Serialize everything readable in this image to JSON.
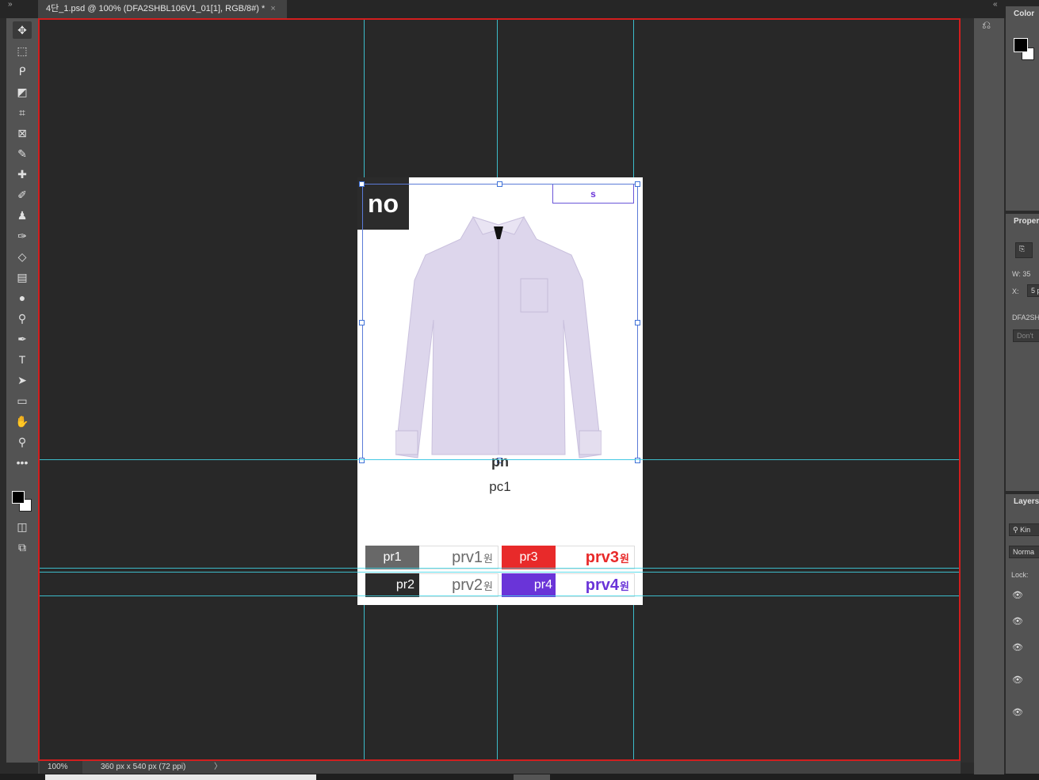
{
  "tab": {
    "title": "4단_1.psd @ 100% (DFA2SHBL106V1_01[1], RGB/8#) *",
    "close": "×"
  },
  "tabbar": {
    "collapse_left": "»",
    "collapse_right": "«"
  },
  "tools": [
    {
      "icon": "move-icon",
      "glyph": "✥"
    },
    {
      "icon": "rect-marquee-icon",
      "glyph": "⬚"
    },
    {
      "icon": "lasso-icon",
      "glyph": "ᑭ"
    },
    {
      "icon": "object-select-icon",
      "glyph": "◩"
    },
    {
      "icon": "crop-icon",
      "glyph": "⌗"
    },
    {
      "icon": "frame-icon",
      "glyph": "⊠"
    },
    {
      "icon": "eyedropper-icon",
      "glyph": "✎"
    },
    {
      "icon": "healing-brush-icon",
      "glyph": "✚"
    },
    {
      "icon": "brush-icon",
      "glyph": "✐"
    },
    {
      "icon": "stamp-icon",
      "glyph": "♟"
    },
    {
      "icon": "history-brush-icon",
      "glyph": "✑"
    },
    {
      "icon": "eraser-icon",
      "glyph": "◇"
    },
    {
      "icon": "gradient-icon",
      "glyph": "▤"
    },
    {
      "icon": "blur-icon",
      "glyph": "●"
    },
    {
      "icon": "dodge-icon",
      "glyph": "⚲"
    },
    {
      "icon": "pen-icon",
      "glyph": "✒"
    },
    {
      "icon": "type-icon",
      "glyph": "T"
    },
    {
      "icon": "path-select-icon",
      "glyph": "➤"
    },
    {
      "icon": "rectangle-icon",
      "glyph": "▭"
    },
    {
      "icon": "hand-icon",
      "glyph": "✋"
    },
    {
      "icon": "zoom-icon",
      "glyph": "⚲"
    },
    {
      "icon": "more-tools-icon",
      "glyph": "•••"
    }
  ],
  "document": {
    "no_badge": "no",
    "s_badge": "s",
    "pn": "pn",
    "pc": "pc1",
    "prices": [
      {
        "label": "pr1",
        "value": "prv1",
        "unit": "원",
        "label_bg": "#686868",
        "value_color": "#6a6a6a"
      },
      {
        "label": "pr3",
        "value": "prv3",
        "unit": "원",
        "label_bg": "#e82a2a",
        "value_color": "#e82a2a"
      },
      {
        "label": "pr2",
        "value": "prv2",
        "unit": "원",
        "label_bg": "#2b2b2b",
        "value_color": "#6a6a6a"
      },
      {
        "label": "pr4",
        "value": "prv4",
        "unit": "원",
        "label_bg": "#6a34d8",
        "value_color": "#6a34d8"
      }
    ]
  },
  "status": {
    "zoom": "100%",
    "doc_info": "360 px x 540 px (72 ppi)",
    "arrow": "〉"
  },
  "panels": {
    "color_title": "Color",
    "properties_title": "Proper",
    "prop_w": "W:  35",
    "prop_x": "X:",
    "prop_x_value": "5 p",
    "prop_layer": "DFA2SH",
    "prop_dont": "Don't",
    "layers_title": "Layers",
    "layers_search": "Kin",
    "layers_blend": "Norma",
    "layers_lock": "Lock:"
  },
  "colors": {
    "canvas_border": "#d21e1e",
    "guide": "#3fd6e6",
    "selection": "#3f72d8"
  }
}
